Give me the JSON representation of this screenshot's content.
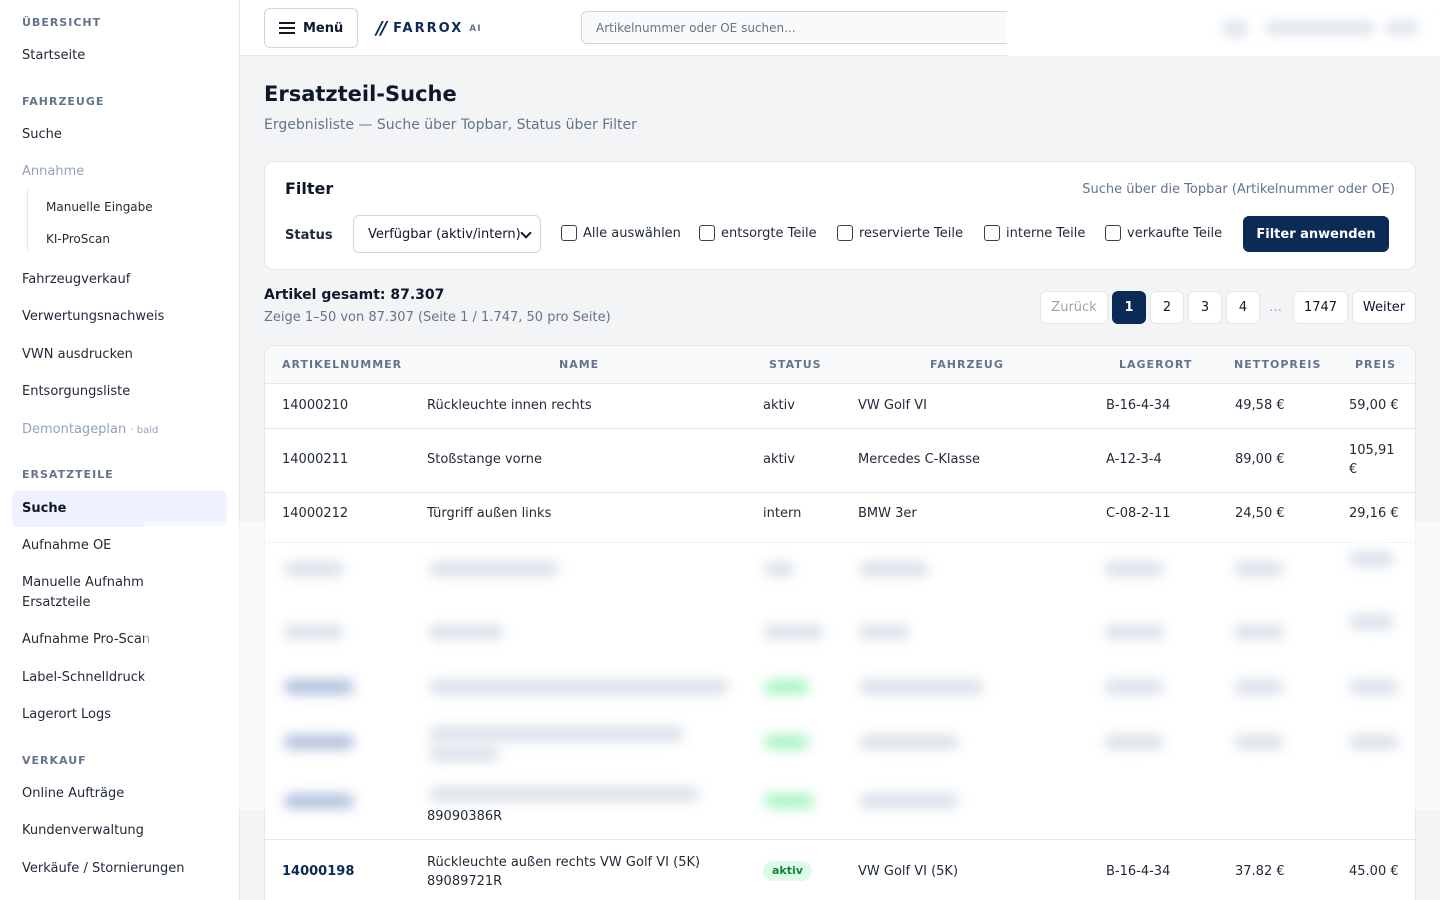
{
  "sidebar": {
    "sections": {
      "uebersicht": "ÜBERSICHT",
      "fahrzeuge": "FAHRZEUGE",
      "ersatzteile": "ERSATZTEILE",
      "verkauf": "VERKAUF"
    },
    "items": {
      "startseite": "Startseite",
      "fz_suche": "Suche",
      "annahme": "Annahme",
      "manuelle_eingabe": "Manuelle Eingabe",
      "ki_proscan": "KI-ProScan",
      "fahrzeugverkauf": "Fahrzeugverkauf",
      "verwertungsnachweis": "Verwertungsnachweis",
      "vwn_ausdrucken": "VWN ausdrucken",
      "entsorgungsliste": "Entsorgungsliste",
      "demontageplan": "Demontageplan",
      "demontageplan_badge": "· bald",
      "et_suche": "Suche",
      "aufnahme_oe": "Aufnahme OE",
      "manuelle_aufnahme_1": "Manuelle Aufnahm",
      "manuelle_aufnahme_2": "Ersatzteile",
      "aufnahme_proscan": "Aufnahme Pro-Scan",
      "label_schnelldruck": "Label-Schnelldruck",
      "lagerort_logs": "Lagerort Logs",
      "online_auftraege": "Online Aufträge",
      "kundenverwaltung": "Kundenverwaltung",
      "verkaeufe_stornierungen": "Verkäufe / Stornierungen"
    }
  },
  "topbar": {
    "menu_label": "Menü",
    "logo_mark": "//",
    "logo_text": "FARROX",
    "logo_suffix": "AI",
    "search_placeholder": "Artikelnummer oder OE suchen..."
  },
  "page": {
    "title": "Ersatzteil-Suche",
    "subtitle": "Ergebnisliste — Suche über Topbar, Status über Filter"
  },
  "filter": {
    "title": "Filter",
    "hint": "Suche über die Topbar (Artikelnummer oder OE)",
    "status_label": "Status",
    "status_value": "Verfügbar (aktiv/intern)",
    "checkboxes": [
      "Alle auswählen",
      "entsorgte Teile",
      "reservierte Teile",
      "interne Teile",
      "verkaufte Teile"
    ],
    "apply_label": "Filter anwenden"
  },
  "results": {
    "total": "Artikel gesamt: 87.307",
    "range": "Zeige 1–50 von 87.307 (Seite 1 / 1.747, 50 pro Seite)"
  },
  "pagination": {
    "prev": "Zurück",
    "pages": [
      "1",
      "2",
      "3",
      "4"
    ],
    "ellipsis": "…",
    "last": "1747",
    "next": "Weiter"
  },
  "table": {
    "headers": [
      "ARTIKELNUMMER",
      "NAME",
      "STATUS",
      "FAHRZEUG",
      "LAGERORT",
      "NETTOPREIS",
      "PREIS"
    ],
    "rows": [
      {
        "artikel": "14000210",
        "name": "Rückleuchte innen rechts",
        "status": "aktiv",
        "fahrzeug": "VW Golf VI",
        "lagerort": "B-16-4-34",
        "netto": "49,58 €",
        "preis": "59,00 €"
      },
      {
        "artikel": "14000211",
        "name": "Stoßstange vorne",
        "status": "aktiv",
        "fahrzeug": "Mercedes C-Klasse",
        "lagerort": "A-12-3-4",
        "netto": "89,00 €",
        "preis_1": "105,91",
        "preis_2": "€"
      },
      {
        "artikel": "14000212",
        "name": "Türgriff außen links",
        "status": "intern",
        "fahrzeug": "BMW 3er",
        "lagerort": "C-08-2-11",
        "netto": "24,50 €",
        "preis": "29,16 €"
      }
    ],
    "partial_row": {
      "name_line2": "89090386R"
    },
    "last_row": {
      "artikel": "14000198",
      "name_1": "Rückleuchte außen rechts VW Golf VI (5K)",
      "name_2": "89089721R",
      "status": "aktiv",
      "fahrzeug": "VW Golf VI (5K)",
      "lagerort": "B-16-4-34",
      "netto": "37.82 €",
      "preis": "45.00 €"
    }
  },
  "colors": {
    "brand": "#0b2a55",
    "active_bg": "#eef2ff",
    "status_green_bg": "#dcfce7",
    "status_green_text": "#15803d"
  }
}
